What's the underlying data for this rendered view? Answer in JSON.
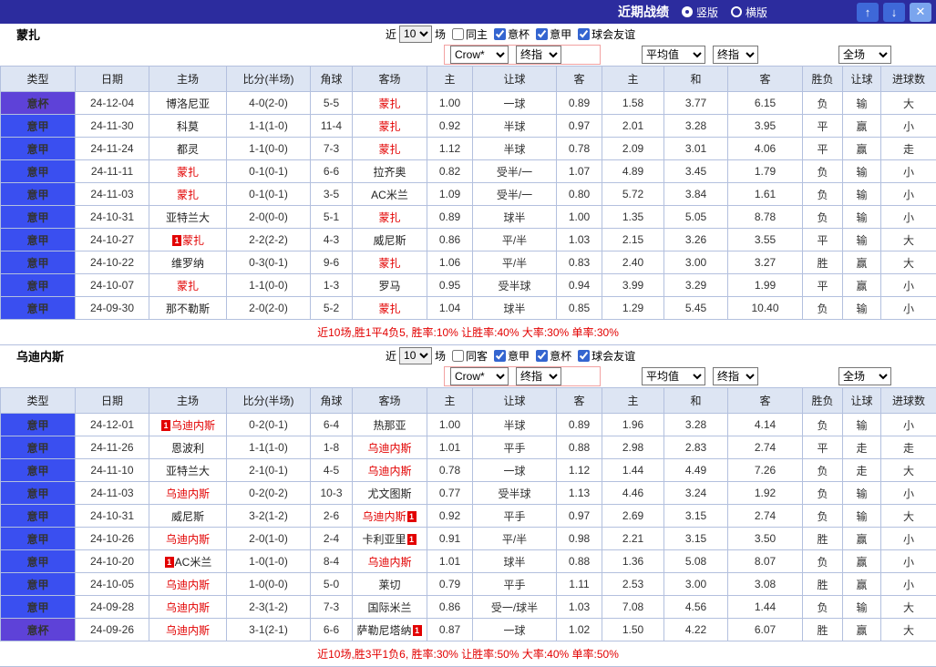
{
  "titlebar": {
    "title": "近期战绩",
    "vertical_label": "竖版",
    "horizontal_label": "横版",
    "up_icon": "↑",
    "down_icon": "↓",
    "close_icon": "✕"
  },
  "columns": [
    "类型",
    "日期",
    "主场",
    "比分(半场)",
    "角球",
    "客场",
    "主",
    "让球",
    "客",
    "主",
    "和",
    "客",
    "胜负",
    "让球",
    "进球数"
  ],
  "dropdowns": {
    "company": "Crow*",
    "final_a": "终指",
    "average": "平均值",
    "final_b": "终指",
    "scope": "全场"
  },
  "colors": {
    "accent_bar": "#2c2c9e",
    "league_blue": "#3a4ff0",
    "cup_purple": "#5e42d8",
    "win_red": "#e20000",
    "draw_green": "#089000",
    "lose_blue": "#1313cf"
  },
  "sections": [
    {
      "team": "蒙扎",
      "filters": {
        "near": "近",
        "count": "10",
        "unit": "场",
        "checks": [
          {
            "label": "同主"
          },
          {
            "label": "意杯",
            "checked_attr": "checked"
          },
          {
            "label": "意甲",
            "checked_attr": "checked"
          },
          {
            "label": "球会友谊",
            "checked_attr": "checked"
          }
        ]
      },
      "summary": "近10场,胜1平4负5, 胜率:10% 让胜率:40% 大率:30% 单率:30%",
      "rows": [
        {
          "type": "意杯",
          "date": "24-12-04",
          "home": "博洛尼亚",
          "score": "4-0(2-0)",
          "corner": "5-5",
          "away": "蒙扎",
          "away_hl": true,
          "asia": [
            "1.00",
            "一球",
            "0.89"
          ],
          "euro": [
            "1.58",
            "3.77",
            "6.15"
          ],
          "res": "负",
          "handicap": "输",
          "goals": "大"
        },
        {
          "type": "意甲",
          "date": "24-11-30",
          "home": "科莫",
          "score": "1-1(1-0)",
          "corner": "11-4",
          "away": "蒙扎",
          "away_hl": true,
          "asia": [
            "0.92",
            "半球",
            "0.97"
          ],
          "euro": [
            "2.01",
            "3.28",
            "3.95"
          ],
          "res": "平",
          "handicap": "赢",
          "goals": "小"
        },
        {
          "type": "意甲",
          "date": "24-11-24",
          "home": "都灵",
          "score": "1-1(0-0)",
          "corner": "7-3",
          "away": "蒙扎",
          "away_hl": true,
          "asia": [
            "1.12",
            "半球",
            "0.78"
          ],
          "euro": [
            "2.09",
            "3.01",
            "4.06"
          ],
          "res": "平",
          "handicap": "赢",
          "goals": "走"
        },
        {
          "type": "意甲",
          "date": "24-11-11",
          "home": "蒙扎",
          "home_hl": true,
          "score": "0-1(0-1)",
          "corner": "6-6",
          "away": "拉齐奥",
          "asia": [
            "0.82",
            "受半/一",
            "1.07"
          ],
          "euro": [
            "4.89",
            "3.45",
            "1.79"
          ],
          "res": "负",
          "handicap": "输",
          "goals": "小"
        },
        {
          "type": "意甲",
          "date": "24-11-03",
          "home": "蒙扎",
          "home_hl": true,
          "score": "0-1(0-1)",
          "corner": "3-5",
          "away": "AC米兰",
          "asia": [
            "1.09",
            "受半/一",
            "0.80"
          ],
          "euro": [
            "5.72",
            "3.84",
            "1.61"
          ],
          "res": "负",
          "handicap": "输",
          "goals": "小"
        },
        {
          "type": "意甲",
          "date": "24-10-31",
          "home": "亚特兰大",
          "score": "2-0(0-0)",
          "corner": "5-1",
          "away": "蒙扎",
          "away_hl": true,
          "asia": [
            "0.89",
            "球半",
            "1.00"
          ],
          "euro": [
            "1.35",
            "5.05",
            "8.78"
          ],
          "res": "负",
          "handicap": "输",
          "goals": "小"
        },
        {
          "type": "意甲",
          "date": "24-10-27",
          "home": "蒙扎",
          "home_hl": true,
          "home_card_pre": "1",
          "score": "2-2(2-2)",
          "corner": "4-3",
          "away": "威尼斯",
          "asia": [
            "0.86",
            "平/半",
            "1.03"
          ],
          "euro": [
            "2.15",
            "3.26",
            "3.55"
          ],
          "res": "平",
          "handicap": "输",
          "goals": "大"
        },
        {
          "type": "意甲",
          "date": "24-10-22",
          "home": "维罗纳",
          "score": "0-3(0-1)",
          "corner": "9-6",
          "away": "蒙扎",
          "away_hl": true,
          "asia": [
            "1.06",
            "平/半",
            "0.83"
          ],
          "euro": [
            "2.40",
            "3.00",
            "3.27"
          ],
          "res": "胜",
          "handicap": "赢",
          "goals": "大"
        },
        {
          "type": "意甲",
          "date": "24-10-07",
          "home": "蒙扎",
          "home_hl": true,
          "score": "1-1(0-0)",
          "corner": "1-3",
          "away": "罗马",
          "asia": [
            "0.95",
            "受半球",
            "0.94"
          ],
          "euro": [
            "3.99",
            "3.29",
            "1.99"
          ],
          "res": "平",
          "handicap": "赢",
          "goals": "小"
        },
        {
          "type": "意甲",
          "date": "24-09-30",
          "home": "那不勒斯",
          "score": "2-0(2-0)",
          "corner": "5-2",
          "away": "蒙扎",
          "away_hl": true,
          "asia": [
            "1.04",
            "球半",
            "0.85"
          ],
          "euro": [
            "1.29",
            "5.45",
            "10.40"
          ],
          "res": "负",
          "handicap": "输",
          "goals": "小"
        }
      ]
    },
    {
      "team": "乌迪内斯",
      "filters": {
        "near": "近",
        "count": "10",
        "unit": "场",
        "checks": [
          {
            "label": "同客"
          },
          {
            "label": "意甲",
            "checked_attr": "checked"
          },
          {
            "label": "意杯",
            "checked_attr": "checked"
          },
          {
            "label": "球会友谊",
            "checked_attr": "checked"
          }
        ]
      },
      "summary": "近10场,胜3平1负6, 胜率:30% 让胜率:50% 大率:40% 单率:50%",
      "rows": [
        {
          "type": "意甲",
          "date": "24-12-01",
          "home": "乌迪内斯",
          "home_hl": true,
          "home_card_pre": "1",
          "score": "0-2(0-1)",
          "corner": "6-4",
          "away": "热那亚",
          "asia": [
            "1.00",
            "半球",
            "0.89"
          ],
          "euro": [
            "1.96",
            "3.28",
            "4.14"
          ],
          "res": "负",
          "handicap": "输",
          "goals": "小"
        },
        {
          "type": "意甲",
          "date": "24-11-26",
          "home": "恩波利",
          "score": "1-1(1-0)",
          "corner": "1-8",
          "away": "乌迪内斯",
          "away_hl": true,
          "asia": [
            "1.01",
            "平手",
            "0.88"
          ],
          "euro": [
            "2.98",
            "2.83",
            "2.74"
          ],
          "res": "平",
          "handicap": "走",
          "goals": "走"
        },
        {
          "type": "意甲",
          "date": "24-11-10",
          "home": "亚特兰大",
          "score": "2-1(0-1)",
          "corner": "4-5",
          "away": "乌迪内斯",
          "away_hl": true,
          "asia": [
            "0.78",
            "一球",
            "1.12"
          ],
          "euro": [
            "1.44",
            "4.49",
            "7.26"
          ],
          "res": "负",
          "handicap": "走",
          "goals": "大"
        },
        {
          "type": "意甲",
          "date": "24-11-03",
          "home": "乌迪内斯",
          "home_hl": true,
          "score": "0-2(0-2)",
          "corner": "10-3",
          "away": "尤文图斯",
          "asia": [
            "0.77",
            "受半球",
            "1.13"
          ],
          "euro": [
            "4.46",
            "3.24",
            "1.92"
          ],
          "res": "负",
          "handicap": "输",
          "goals": "小"
        },
        {
          "type": "意甲",
          "date": "24-10-31",
          "home": "威尼斯",
          "score": "3-2(1-2)",
          "corner": "2-6",
          "away": "乌迪内斯",
          "away_hl": true,
          "away_card_post": "1",
          "asia": [
            "0.92",
            "平手",
            "0.97"
          ],
          "euro": [
            "2.69",
            "3.15",
            "2.74"
          ],
          "res": "负",
          "handicap": "输",
          "goals": "大"
        },
        {
          "type": "意甲",
          "date": "24-10-26",
          "home": "乌迪内斯",
          "home_hl": true,
          "score": "2-0(1-0)",
          "corner": "2-4",
          "away": "卡利亚里",
          "away_card_post": "1",
          "asia": [
            "0.91",
            "平/半",
            "0.98"
          ],
          "euro": [
            "2.21",
            "3.15",
            "3.50"
          ],
          "res": "胜",
          "handicap": "赢",
          "goals": "小"
        },
        {
          "type": "意甲",
          "date": "24-10-20",
          "home": "AC米兰",
          "home_card_pre": "1",
          "score": "1-0(1-0)",
          "corner": "8-4",
          "away": "乌迪内斯",
          "away_hl": true,
          "asia": [
            "1.01",
            "球半",
            "0.88"
          ],
          "euro": [
            "1.36",
            "5.08",
            "8.07"
          ],
          "res": "负",
          "handicap": "赢",
          "goals": "小"
        },
        {
          "type": "意甲",
          "date": "24-10-05",
          "home": "乌迪内斯",
          "home_hl": true,
          "score": "1-0(0-0)",
          "corner": "5-0",
          "away": "莱切",
          "asia": [
            "0.79",
            "平手",
            "1.11"
          ],
          "euro": [
            "2.53",
            "3.00",
            "3.08"
          ],
          "res": "胜",
          "handicap": "赢",
          "goals": "小"
        },
        {
          "type": "意甲",
          "date": "24-09-28",
          "home": "乌迪内斯",
          "home_hl": true,
          "score": "2-3(1-2)",
          "corner": "7-3",
          "away": "国际米兰",
          "asia": [
            "0.86",
            "受一/球半",
            "1.03"
          ],
          "euro": [
            "7.08",
            "4.56",
            "1.44"
          ],
          "res": "负",
          "handicap": "输",
          "goals": "大"
        },
        {
          "type": "意杯",
          "date": "24-09-26",
          "home": "乌迪内斯",
          "home_hl": true,
          "score": "3-1(2-1)",
          "corner": "6-6",
          "away": "萨勒尼塔纳",
          "away_card_post": "1",
          "asia": [
            "0.87",
            "一球",
            "1.02"
          ],
          "euro": [
            "1.50",
            "4.22",
            "6.07"
          ],
          "res": "胜",
          "handicap": "赢",
          "goals": "大"
        }
      ]
    }
  ]
}
